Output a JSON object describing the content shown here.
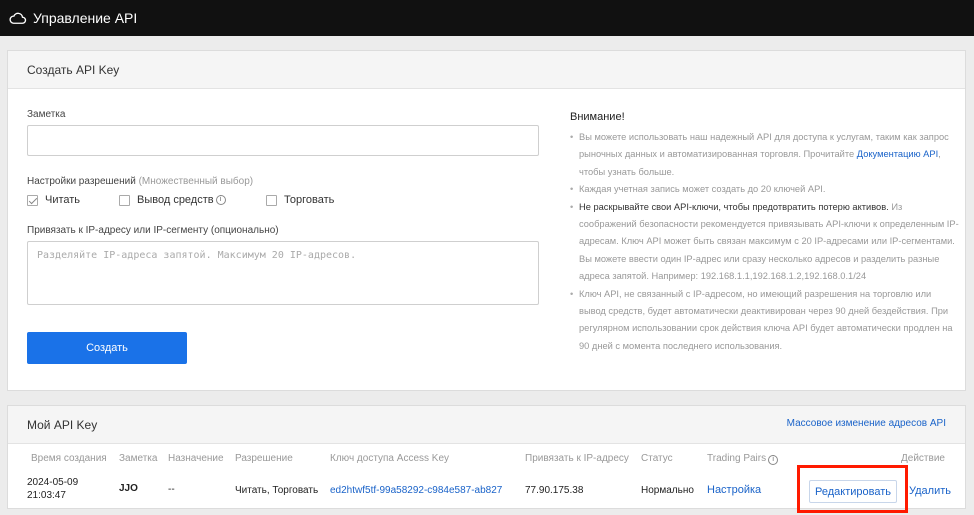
{
  "header": {
    "title": "Управление API",
    "icon": "cloud-icon"
  },
  "create": {
    "title": "Создать API Key",
    "note_label": "Заметка",
    "note_value": "",
    "perm_label": "Настройки разрешений",
    "perm_hint": "(Множественный выбор)",
    "perms": [
      {
        "label": "Читать",
        "checked": true
      },
      {
        "label": "Вывод средств",
        "checked": false
      },
      {
        "label": "Торговать",
        "checked": false
      }
    ],
    "ip_label": "Привязать к IP-адресу или IP-сегменту (опционально)",
    "ip_placeholder": "Разделяйте IP-адреса запятой. Максимум 20 IP-адресов.",
    "submit": "Создать"
  },
  "notice": {
    "title": "Внимание!",
    "line1a": "Вы можете использовать наш надежный API для доступа к услугам, таким как запрос рыночных данных и автоматизированная торговля. Прочитайте",
    "line1_link": "Документацию API",
    "line1b": ", чтобы узнать больше.",
    "line2": "Каждая учетная запись может создать до 20 ключей API.",
    "line3_dark": "Не раскрывайте свои API-ключи, чтобы предотвратить потерю активов.",
    "line3_rest": " Из соображений безопасности рекомендуется привязывать API-ключи к определенным IP-адресам. Ключ API может быть связан максимум с 20 IP-адресами или IP-сегментами. Вы можете ввести один IP-адрес или сразу несколько адресов и разделить разные адреса запятой. Например: 192.168.1.1,192.168.1.2,192.168.0.1/24",
    "line4": "Ключ API, не связанный с IP-адресом, но имеющий разрешения на торговлю или вывод средств, будет автоматически деактивирован через 90 дней бездействия. При регулярном использовании срок действия ключа API будет автоматически продлен на 90 дней с момента последнего использования."
  },
  "mykeys": {
    "title": "Мой API Key",
    "mass_edit": "Массовое изменение адресов API",
    "columns": {
      "created": "Время создания",
      "note": "Заметка",
      "purpose": "Назначение",
      "permission": "Разрешение",
      "access_key": "Ключ доступа Access Key",
      "ip": "Привязать к IP-адресу",
      "status": "Статус",
      "pairs": "Trading Pairs",
      "action": "Действие"
    },
    "row": {
      "date": "2024-05-09",
      "time": "21:03:47",
      "note": "JJO",
      "purpose": "--",
      "permission": "Читать, Торговать",
      "access_key": "ed2htwf5tf-99a58292-c984e587-ab827",
      "ip": "77.90.175.38",
      "status": "Нормально",
      "pairs": "Настройка",
      "edit": "Редактировать",
      "delete": "Удалить"
    }
  },
  "colors": {
    "accent": "#1a72e8",
    "link": "#1a63c9",
    "highlight": "#ff1a00"
  }
}
